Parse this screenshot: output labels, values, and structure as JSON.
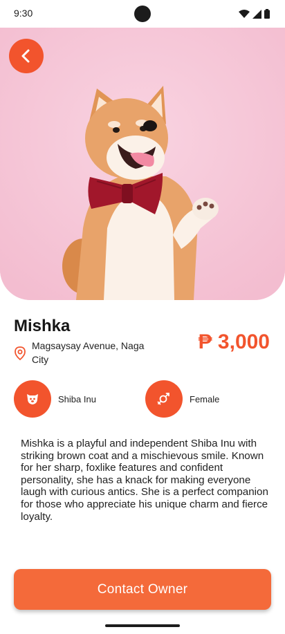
{
  "status_bar": {
    "time": "9:30"
  },
  "pet": {
    "name": "Mishka",
    "location": "Magsaysay Avenue, Naga City",
    "price": "₱ 3,000",
    "breed": "Shiba Inu",
    "sex": "Female",
    "description": "Mishka is a playful and independent Shiba Inu with striking brown coat and a mischievous smile. Known for her sharp, foxlike features and confident personality, she has a knack for making everyone laugh with curious antics. She is a perfect companion for those who appreciate his unique charm and fierce loyalty."
  },
  "actions": {
    "contact_label": "Contact Owner"
  },
  "colors": {
    "accent": "#f2542d",
    "button": "#f46a3a",
    "hero_background": "#f6c6d7"
  },
  "icons": {
    "back": "chevron-left-icon",
    "location": "location-pin-icon",
    "breed": "dog-face-icon",
    "sex": "gender-icon",
    "wifi": "wifi-icon",
    "signal": "signal-icon",
    "battery": "battery-icon"
  }
}
